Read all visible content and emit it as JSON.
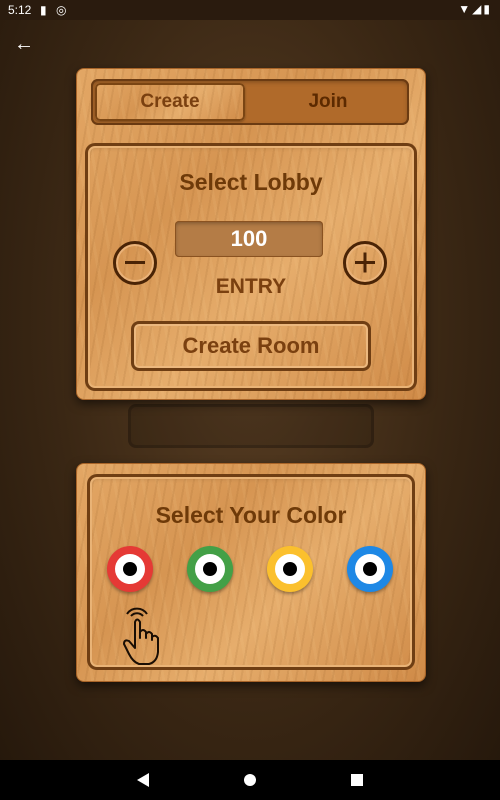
{
  "status_bar": {
    "time": "5:12"
  },
  "tabs": {
    "create": "Create",
    "join": "Join"
  },
  "lobby": {
    "title": "Select Lobby",
    "entry_value": "100",
    "entry_label": "ENTRY",
    "create_room": "Create Room"
  },
  "color_panel": {
    "title": "Select Your Color",
    "colors": [
      {
        "name": "red",
        "hex": "#e53935"
      },
      {
        "name": "green",
        "hex": "#43a047"
      },
      {
        "name": "yellow",
        "hex": "#fbc02d"
      },
      {
        "name": "blue",
        "hex": "#1e88e5"
      }
    ]
  },
  "icons": {
    "back": "arrow-left-icon",
    "minus": "minus-circle-icon",
    "plus": "plus-circle-icon",
    "hand": "tap-hand-icon",
    "nav_back": "triangle-back-icon",
    "nav_home": "circle-home-icon",
    "nav_recent": "square-recent-icon"
  }
}
